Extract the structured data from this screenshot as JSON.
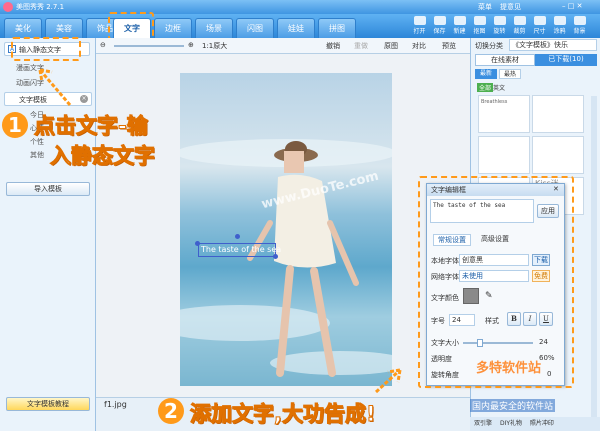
{
  "app": {
    "title": "美图秀秀 2.7.1",
    "menu_label": "菜单",
    "feedback_label": "提意见"
  },
  "nav": {
    "tabs": [
      "美化",
      "美容",
      "饰品",
      "文字",
      "边框",
      "场景",
      "闪图",
      "娃娃",
      "拼图"
    ],
    "active": "文字"
  },
  "toolbar": [
    {
      "label": "打开",
      "icon": "folder-icon"
    },
    {
      "label": "保存",
      "icon": "save-icon"
    },
    {
      "label": "新建",
      "icon": "new-icon"
    },
    {
      "label": "抠图",
      "icon": "cutout-icon"
    },
    {
      "label": "旋转",
      "icon": "rotate-icon"
    },
    {
      "label": "裁剪",
      "icon": "crop-icon"
    },
    {
      "label": "尺寸",
      "icon": "resize-icon"
    },
    {
      "label": "涂鸦",
      "icon": "doodle-icon"
    },
    {
      "label": "背景",
      "icon": "background-icon"
    }
  ],
  "left_panel": {
    "input_static_text": "输入静态文字",
    "item2": "漫画文字",
    "item3": "动画闪字",
    "template_label": "文字模板",
    "sub_items": [
      "今日",
      "心情",
      "个性",
      "其他"
    ],
    "import_template": "导入模板",
    "tutorial": "文字模板教程"
  },
  "canvas_bar": {
    "zoom": "1:1原大",
    "undo": "撤销",
    "redo": "重做",
    "original": "原图",
    "compare": "对比",
    "preview": "预览"
  },
  "file_name": "f1.jpg",
  "watermark": "www.DuoTe.com",
  "photo_text": "The taste of the sea",
  "right_panel": {
    "category_label": "切换分类",
    "category_value": "《文字模板》快乐",
    "tab_online": "在线素材",
    "tab_downloaded": "已下载(10)",
    "filter_latest": "最新",
    "filter_hot": "最热",
    "lang_all": "全部",
    "lang_en": "英文",
    "thumb1": "Breathless",
    "thumb2": "Kiss迷"
  },
  "editor": {
    "title": "文字编辑框",
    "text_value": "The taste of the sea",
    "apply": "应用",
    "tab_normal": "常规设置",
    "tab_advanced": "高级设置",
    "local_font_label": "本地字体",
    "local_font_value": "创意黑",
    "download": "下载",
    "web_font_label": "网络字体",
    "web_font_value": "未使用",
    "free": "免费",
    "color_label": "文字颜色",
    "size_label": "字号",
    "size_value": "24",
    "style_label": "样式",
    "bold": "B",
    "italic": "I",
    "underline": "U",
    "text_size_label": "文字大小",
    "text_size_value": "24",
    "opacity_label": "透明度",
    "opacity_value": "60%",
    "rotation_label": "旋转角度",
    "rotation_value": "0"
  },
  "annotations": {
    "num1": "1",
    "step1_line1": "点击文字-输",
    "step1_line2": "入静态文字",
    "num2": "2",
    "step2": "添加文字,大功告成!"
  },
  "bottom_status": {
    "item1": "双引擎",
    "item2": "DIY礼物",
    "item3": "照片冲印"
  },
  "watermark2": {
    "line1": "多特软件站",
    "line2": "国内最安全的软件站"
  },
  "colors": {
    "accent": "#ff9a1a",
    "nav_blue": "#2d86d8"
  }
}
